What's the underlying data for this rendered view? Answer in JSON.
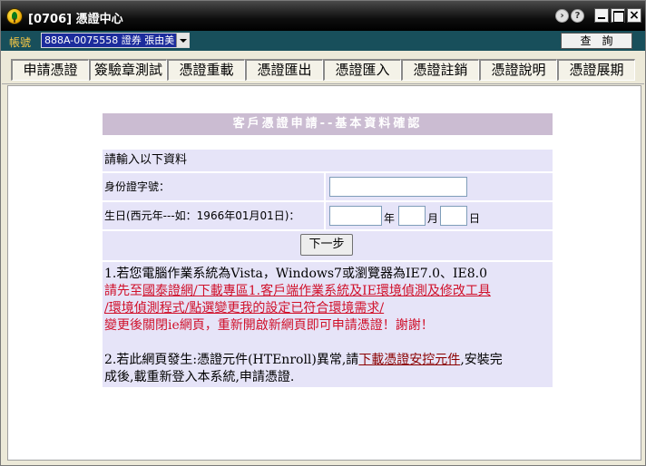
{
  "window": {
    "title": "[0706] 憑證中心"
  },
  "account_bar": {
    "label": "帳號",
    "account_value": "888A-0075558  證券  張由美",
    "query_button": "查詢"
  },
  "tabs": [
    {
      "label": "申請憑證"
    },
    {
      "label": "簽驗章測試"
    },
    {
      "label": "憑證重載"
    },
    {
      "label": "憑證匯出"
    },
    {
      "label": "憑證匯入"
    },
    {
      "label": "憑證註銷"
    },
    {
      "label": "憑證說明"
    },
    {
      "label": "憑證展期"
    }
  ],
  "form": {
    "title": "客戶憑證申請--基本資料確認",
    "prompt": "請輸入以下資料",
    "id_label": "身份證字號：",
    "birth_label": "生日(西元年---如：1966年01月01日)：",
    "unit_year": "年",
    "unit_month": "月",
    "unit_day": "日",
    "next_button": "下一步"
  },
  "notice": {
    "line1": "1.若您電腦作業系統為Vista，Windows7或瀏覽器為IE7.0、IE8.0",
    "line2_prefix": "請先至",
    "line2_link": "國泰證網/下載專區1.客戶端作業系統及IE環境偵測及修改工具",
    "line3": "/環境偵測程式/點選變更我的設定已符合環境需求/",
    "line4": "變更後關閉ie網頁，重新開啟新網頁即可申請憑證！謝謝！",
    "line5_prefix": "2.若此網頁發生:憑證元件(HTEnroll)異常,請",
    "line5_link": "下載憑證安控元件",
    "line5_suffix": ",安裝完",
    "line6": "成後,載重新登入本系統,申請憑證."
  }
}
